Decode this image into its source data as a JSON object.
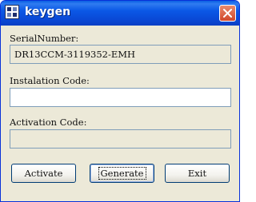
{
  "window": {
    "title": "keygen",
    "icon": "keygen-app-icon",
    "close_icon": "close-icon"
  },
  "fields": {
    "serial_number": {
      "label": "SerialNumber:",
      "value": "DR13CCM-3119352-EMH"
    },
    "installation_code": {
      "label": "Instalation Code:",
      "value": ""
    },
    "activation_code": {
      "label": "Activation Code:",
      "value": ""
    }
  },
  "buttons": {
    "activate": "Activate",
    "generate": "Generate",
    "exit": "Exit"
  },
  "colors": {
    "titlebar": "#0a55e0",
    "window_bg": "#ece9d8",
    "close_button": "#d1472a"
  }
}
